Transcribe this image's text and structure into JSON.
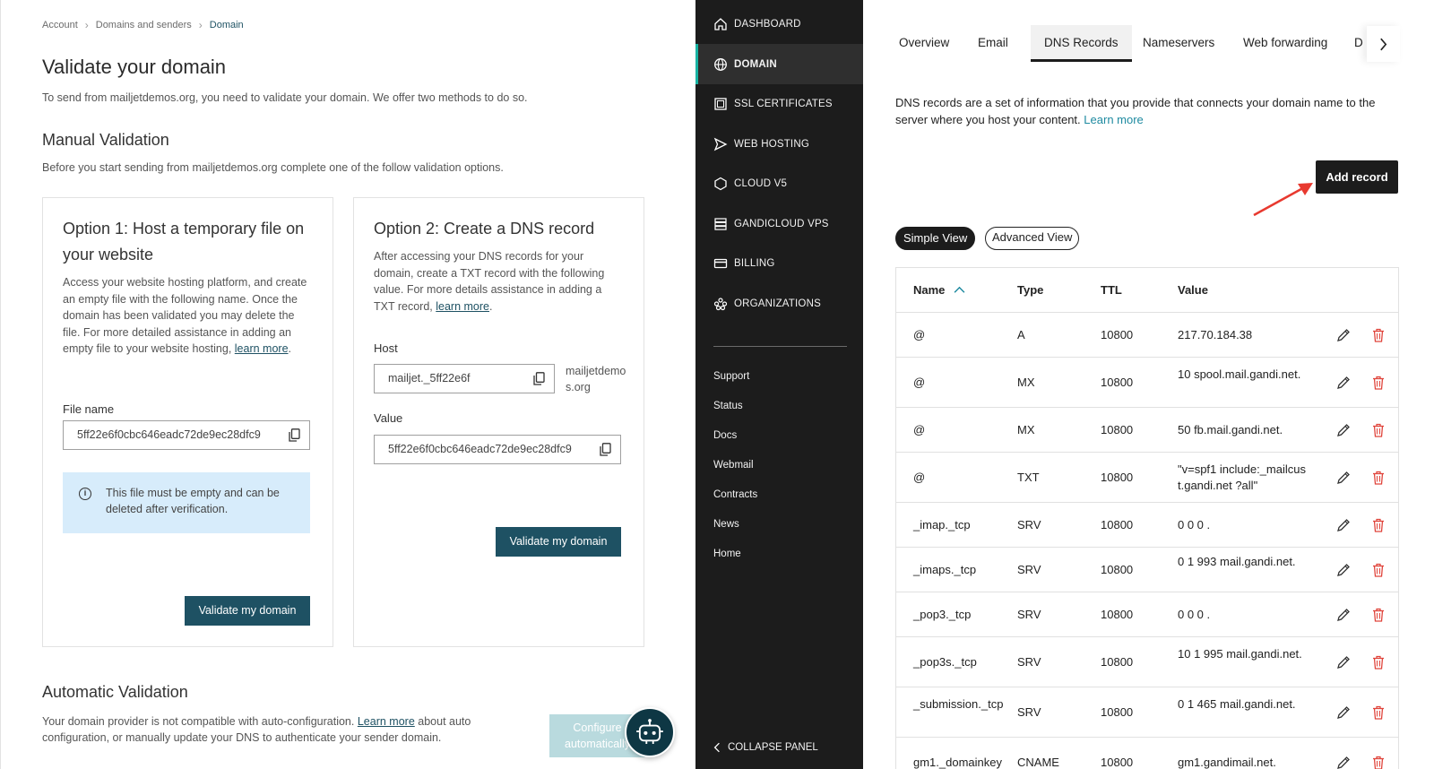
{
  "left_panel": {
    "breadcrumb": [
      "Account",
      "Domains and senders",
      "Domain"
    ],
    "title": "Validate your domain",
    "intro": "To send from mailjetdemos.org, you need to validate your domain. We offer two methods to do so.",
    "manual": {
      "heading": "Manual Validation",
      "text": "Before you start sending from mailjetdemos.org complete one of the follow validation options."
    },
    "option1": {
      "title": "Option 1: Host a temporary file on your website",
      "desc": "Access your website hosting platform, and create an empty file with the following name. Once the domain has been validated you may delete the file. For more detailed assistance in adding an empty file to your website hosting,",
      "desc_link": "learn more",
      "file_label": "File name",
      "file_value": "5ff22e6f0cbc646eadc72de9ec28dfc9",
      "info": "This file must be empty and can be deleted after verification.",
      "button": "Validate my domain"
    },
    "option2": {
      "title": "Option 2: Create a DNS record",
      "desc": "After accessing your DNS records for your domain, create a TXT record with the following value. For more details assistance in adding a TXT record,",
      "desc_link": "learn more",
      "host_label": "Host",
      "host_value": "mailjet._5ff22e6f",
      "host_suffix": "mailjetdemos.org",
      "value_label": "Value",
      "value_value": "5ff22e6f0cbc646eadc72de9ec28dfc9",
      "button": "Validate my domain"
    },
    "automatic": {
      "heading": "Automatic Validation",
      "text_before": "Your domain provider is not compatible with auto-configuration.",
      "link": "Learn more",
      "text_after": "about auto configuration, or manually update your DNS to authenticate your sender domain.",
      "button": "Configure automatically"
    }
  },
  "sidebar": {
    "items": [
      {
        "label": "DASHBOARD",
        "icon": "home-icon"
      },
      {
        "label": "DOMAIN",
        "icon": "globe-icon",
        "active": true
      },
      {
        "label": "SSL CERTIFICATES",
        "icon": "certificate-icon"
      },
      {
        "label": "WEB HOSTING",
        "icon": "send-icon"
      },
      {
        "label": "CLOUD V5",
        "icon": "cloud-hex-icon"
      },
      {
        "label": "GANDICLOUD VPS",
        "icon": "server-icon"
      },
      {
        "label": "BILLING",
        "icon": "credit-card-icon"
      },
      {
        "label": "ORGANIZATIONS",
        "icon": "organizations-icon"
      }
    ],
    "links": [
      "Support",
      "Status",
      "Docs",
      "Webmail",
      "Contracts",
      "News",
      "Home"
    ],
    "collapse": "COLLAPSE PANEL",
    "accent": "#17b3a3"
  },
  "main": {
    "tabs": [
      "Overview",
      "Email",
      "DNS Records",
      "Nameservers",
      "Web forwarding",
      "D"
    ],
    "active_tab": "DNS Records",
    "intro": "DNS records are a set of information that you provide that connects your domain name to the server where you host your content.",
    "intro_link": "Learn more",
    "add_button": "Add record",
    "views": [
      "Simple View",
      "Advanced View"
    ],
    "columns": [
      "Name",
      "Type",
      "TTL",
      "Value"
    ],
    "records": [
      {
        "name": "@",
        "type": "A",
        "ttl": "10800",
        "value": "217.70.184.38"
      },
      {
        "name": "@",
        "type": "MX",
        "ttl": "10800",
        "value": "10 spool.mail.gandi.net."
      },
      {
        "name": "@",
        "type": "MX",
        "ttl": "10800",
        "value": "50 fb.mail.gandi.net."
      },
      {
        "name": "@",
        "type": "TXT",
        "ttl": "10800",
        "value": "\"v=spf1 include:_mailcust.gandi.net ?all\""
      },
      {
        "name": "_imap._tcp",
        "type": "SRV",
        "ttl": "10800",
        "value": "0 0 0 ."
      },
      {
        "name": "_imaps._tcp",
        "type": "SRV",
        "ttl": "10800",
        "value": "0 1 993 mail.gandi.net."
      },
      {
        "name": "_pop3._tcp",
        "type": "SRV",
        "ttl": "10800",
        "value": "0 0 0 ."
      },
      {
        "name": "_pop3s._tcp",
        "type": "SRV",
        "ttl": "10800",
        "value": "10 1 995 mail.gandi.net."
      },
      {
        "name": "_submission._tcp",
        "type": "SRV",
        "ttl": "10800",
        "value": "0 1 465 mail.gandi.net."
      },
      {
        "name": "gm1._domainkey",
        "type": "CNAME",
        "ttl": "10800",
        "value": "gm1.gandimail.net."
      }
    ]
  }
}
